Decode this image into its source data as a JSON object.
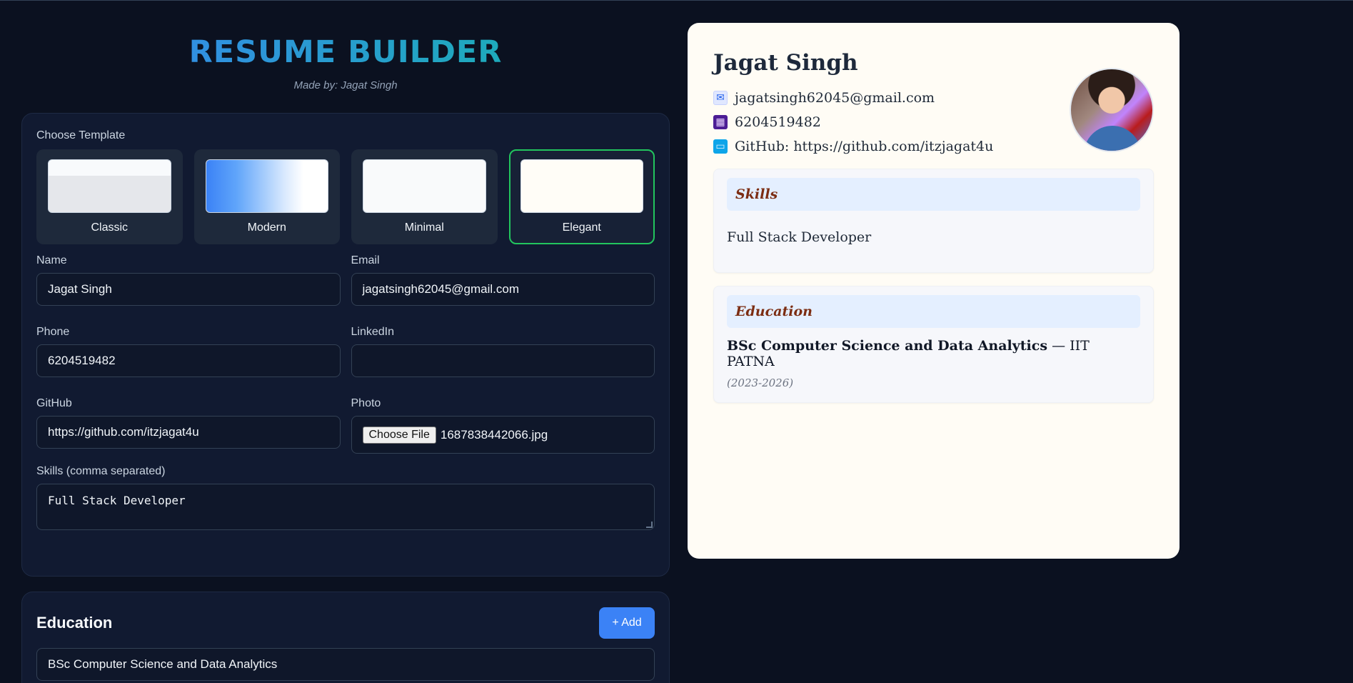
{
  "header": {
    "title": "RESUME BUILDER",
    "subtitle": "Made by: Jagat Singh"
  },
  "form": {
    "template_label": "Choose Template",
    "templates": [
      {
        "label": "Classic",
        "selected": false
      },
      {
        "label": "Modern",
        "selected": false
      },
      {
        "label": "Minimal",
        "selected": false
      },
      {
        "label": "Elegant",
        "selected": true
      }
    ],
    "name": {
      "label": "Name",
      "value": "Jagat Singh"
    },
    "email": {
      "label": "Email",
      "value": "jagatsingh62045@gmail.com"
    },
    "phone": {
      "label": "Phone",
      "value": "6204519482"
    },
    "linkedin": {
      "label": "LinkedIn",
      "value": ""
    },
    "github": {
      "label": "GitHub",
      "value": "https://github.com/itzjagat4u"
    },
    "photo": {
      "label": "Photo",
      "button": "Choose File",
      "filename": "1687838442066.jpg"
    },
    "skills": {
      "label": "Skills (comma separated)",
      "value": "Full Stack Developer"
    }
  },
  "education_editor": {
    "title": "Education",
    "add_button": "+ Add",
    "entries": [
      {
        "degree": "BSc Computer Science and Data Analytics"
      }
    ]
  },
  "preview": {
    "name": "Jagat Singh",
    "email": "jagatsingh62045@gmail.com",
    "phone": "6204519482",
    "github_prefix": "GitHub: ",
    "github": "https://github.com/itzjagat4u",
    "icons": {
      "email": "email-icon",
      "phone": "phone-icon",
      "github": "laptop-icon"
    },
    "skills_title": "Skills",
    "skills_text": "Full Stack Developer",
    "education_title": "Education",
    "education": [
      {
        "degree": "BSc Computer Science and Data Analytics",
        "separator": " — ",
        "institute": "IIT PATNA",
        "years": "(2023-2026)"
      }
    ]
  },
  "colors": {
    "background": "#0b1120",
    "accent": "#3b82f6",
    "selected_border": "#22c55e",
    "section_title": "#7c2d12"
  }
}
